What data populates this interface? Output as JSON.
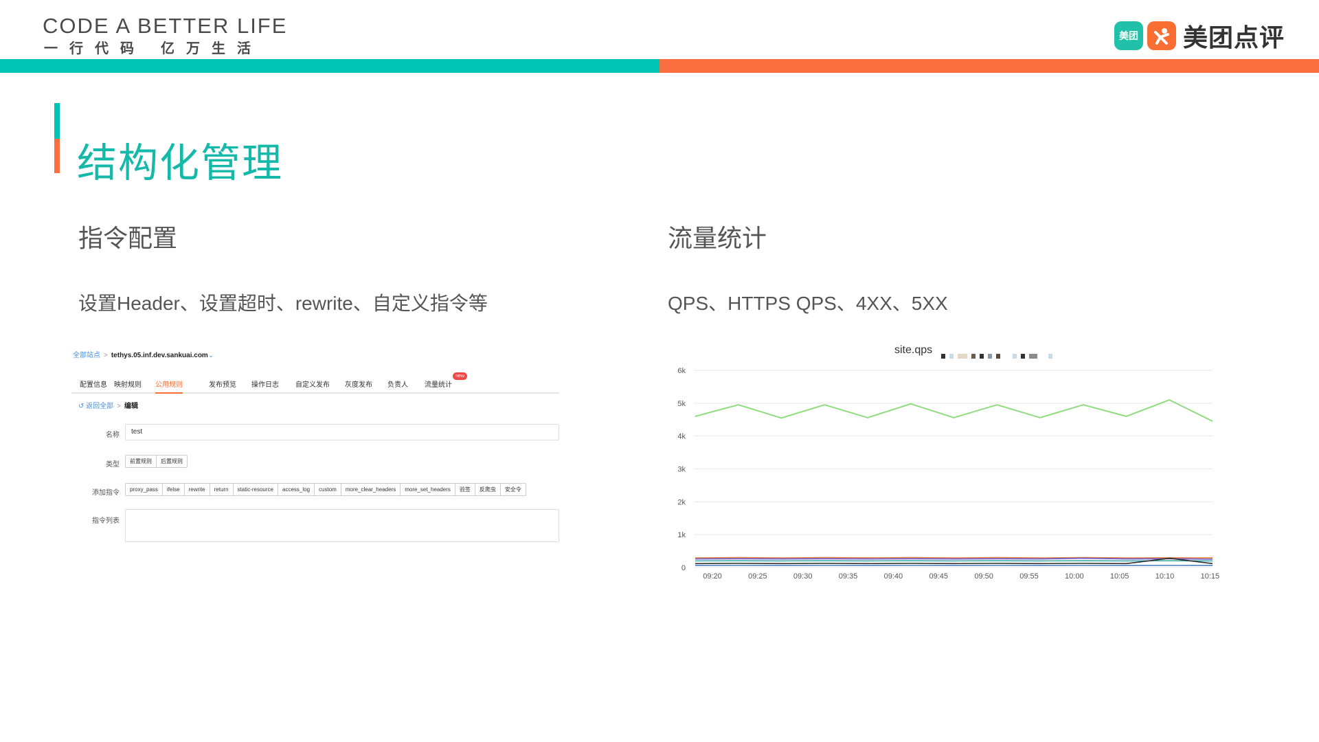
{
  "header": {
    "brand_en": "CODE A BETTER LIFE",
    "brand_cn_left": "一行代码",
    "brand_cn_right": "亿万生活",
    "logo_badge": "美团",
    "logo_text": "美团点评"
  },
  "colors": {
    "teal": "#00c4b4",
    "orange": "#fb6e40",
    "title": "#14b9a9"
  },
  "page_title": "结构化管理",
  "left": {
    "heading": "指令配置",
    "desc": "设置Header、设置超时、rewrite、自定义指令等",
    "mock": {
      "breadcrumb_home": "全部站点",
      "breadcrumb_host": "tethys.05.inf.dev.sankuai.com",
      "tabs": [
        {
          "label": "配置信息",
          "active": false
        },
        {
          "label": "映射规则",
          "active": false
        },
        {
          "label": "公用规则",
          "active": true
        },
        {
          "label": "发布预览",
          "active": false
        },
        {
          "label": "操作日志",
          "active": false
        },
        {
          "label": "自定义发布",
          "active": false
        },
        {
          "label": "灰度发布",
          "active": false
        },
        {
          "label": "负责人",
          "active": false
        },
        {
          "label": "流量统计",
          "active": false,
          "badge": "new"
        }
      ],
      "back_label": "返回全部",
      "back_current": "编辑",
      "name_label": "名称",
      "name_value": "test",
      "type_label": "类型",
      "type_options": [
        "前置规则",
        "后置规则"
      ],
      "add_label": "添加指令",
      "directives": [
        "proxy_pass",
        "ifelse",
        "rewrite",
        "return",
        "static-resource",
        "access_log",
        "custom",
        "more_clear_headers",
        "more_set_headers",
        "验签",
        "反爬虫",
        "安全令"
      ],
      "list_label": "指令列表"
    }
  },
  "right": {
    "heading": "流量统计",
    "desc": "QPS、HTTPS QPS、4XX、5XX"
  },
  "chart_data": {
    "type": "line",
    "title": "site.qps",
    "x": [
      "09:20",
      "09:25",
      "09:30",
      "09:35",
      "09:40",
      "09:45",
      "09:50",
      "09:55",
      "10:00",
      "10:05",
      "10:10",
      "10:15"
    ],
    "ylim": [
      0,
      6000
    ],
    "yticks": [
      "0",
      "1k",
      "2k",
      "3k",
      "4k",
      "5k",
      "6k"
    ],
    "grid": true,
    "series": [
      {
        "color": "#8fdc7e",
        "values": [
          4600,
          4950,
          4550,
          4950,
          4560,
          4980,
          4560,
          4950,
          4560,
          4950,
          4600,
          5100,
          4450
        ]
      },
      {
        "color": "#e07a3c",
        "values": [
          290,
          300,
          290,
          300,
          295,
          300,
          290,
          300,
          290,
          300,
          290,
          295,
          290
        ]
      },
      {
        "color": "#6b5bd6",
        "values": [
          260,
          265,
          260,
          265,
          260,
          265,
          260,
          265,
          260,
          280,
          260,
          265,
          250
        ]
      },
      {
        "color": "#3aa6a6",
        "values": [
          200,
          205,
          200,
          205,
          200,
          205,
          200,
          205,
          200,
          205,
          200,
          205,
          200
        ]
      },
      {
        "color": "#2b2b2b",
        "values": [
          120,
          125,
          120,
          125,
          120,
          125,
          120,
          125,
          120,
          125,
          120,
          280,
          120
        ]
      },
      {
        "color": "#4a7fc0",
        "values": [
          60,
          62,
          60,
          62,
          60,
          62,
          60,
          62,
          60,
          62,
          60,
          62,
          60
        ]
      }
    ]
  }
}
